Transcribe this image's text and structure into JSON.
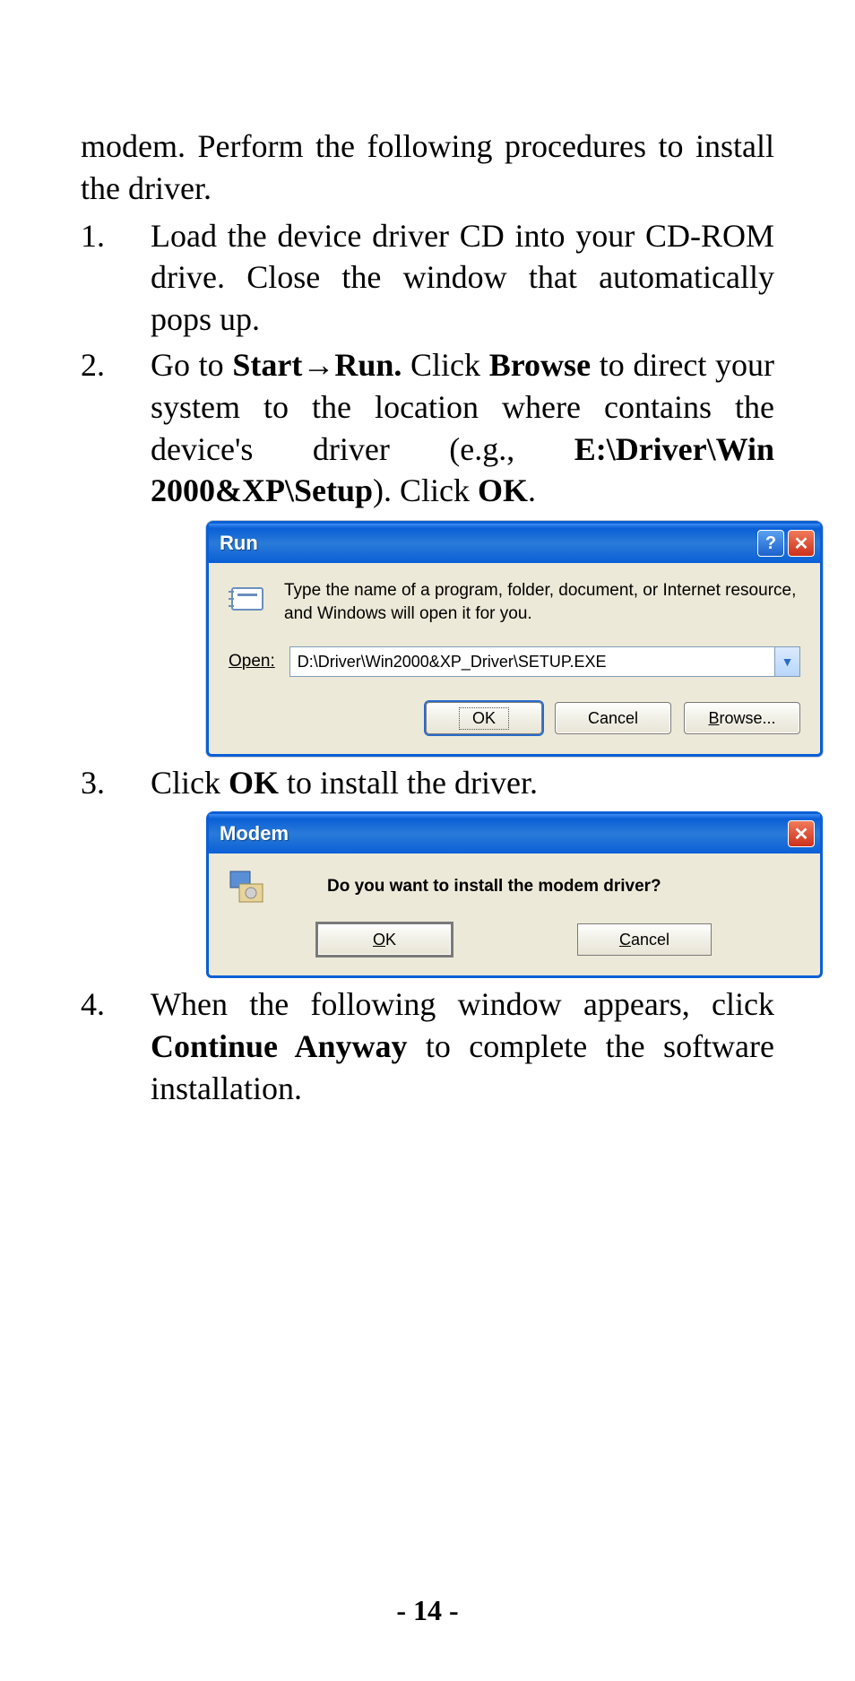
{
  "intro": "modem.   Perform  the  following  procedures  to install the driver.",
  "list": {
    "n1": "1.",
    "n2": "2.",
    "n3": "3.",
    "n4": "4.",
    "item1": "Load the device driver CD into your CD-ROM   drive.      Close   the   window   that automatically pops up.",
    "item2_a": "Go   to   ",
    "item2_start": "Start",
    "item2_arrow": "→",
    "item2_run": "Run.",
    "item2_b": "     Click   ",
    "item2_browse": "Browse",
    "item2_c": "   to direct  your  system  to  the  location  where contains     the     device's     driver     (e.g., ",
    "item2_path": "E:\\Driver\\Win  2000&XP\\Setup",
    "item2_d": ").    Click ",
    "item2_ok": "OK",
    "item2_e": ".",
    "item3_a": "Click ",
    "item3_ok": "OK",
    "item3_b": " to install the driver.",
    "item4_a": "When   the   following   window   appears, click  ",
    "item4_cont": "Continue  Anyway",
    "item4_b": "  to  complete  the software installation."
  },
  "run_dialog": {
    "title": "Run",
    "help": "?",
    "close": "✕",
    "hint": "Type the name of a program, folder, document, or Internet resource, and Windows will open it for you.",
    "open_label_u": "O",
    "open_label_r": "pen:",
    "input_value": "D:\\Driver\\Win2000&XP_Driver\\SETUP.EXE",
    "dropdown_glyph": "▼",
    "btn_ok": "OK",
    "btn_cancel": "Cancel",
    "btn_browse_u": "B",
    "btn_browse_r": "rowse..."
  },
  "modem_dialog": {
    "title": "Modem",
    "close": "✕",
    "message": "Do you want to install the modem driver?",
    "btn_ok_u": "O",
    "btn_ok_r": "K",
    "btn_cancel_u": "C",
    "btn_cancel_r": "ancel"
  },
  "page_number": "- 14 -"
}
